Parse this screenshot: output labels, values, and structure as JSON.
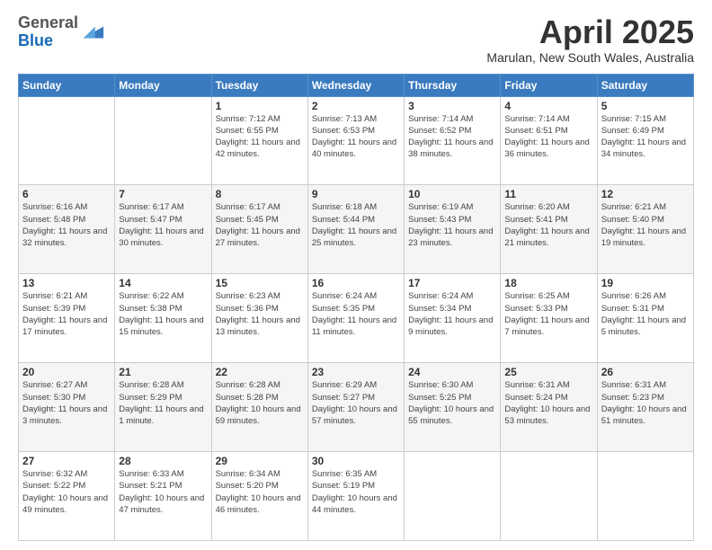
{
  "logo": {
    "line1": "General",
    "line2": "Blue"
  },
  "header": {
    "title": "April 2025",
    "location": "Marulan, New South Wales, Australia"
  },
  "days_of_week": [
    "Sunday",
    "Monday",
    "Tuesday",
    "Wednesday",
    "Thursday",
    "Friday",
    "Saturday"
  ],
  "weeks": [
    [
      {
        "day": "",
        "info": ""
      },
      {
        "day": "",
        "info": ""
      },
      {
        "day": "1",
        "info": "Sunrise: 7:12 AM\nSunset: 6:55 PM\nDaylight: 11 hours and 42 minutes."
      },
      {
        "day": "2",
        "info": "Sunrise: 7:13 AM\nSunset: 6:53 PM\nDaylight: 11 hours and 40 minutes."
      },
      {
        "day": "3",
        "info": "Sunrise: 7:14 AM\nSunset: 6:52 PM\nDaylight: 11 hours and 38 minutes."
      },
      {
        "day": "4",
        "info": "Sunrise: 7:14 AM\nSunset: 6:51 PM\nDaylight: 11 hours and 36 minutes."
      },
      {
        "day": "5",
        "info": "Sunrise: 7:15 AM\nSunset: 6:49 PM\nDaylight: 11 hours and 34 minutes."
      }
    ],
    [
      {
        "day": "6",
        "info": "Sunrise: 6:16 AM\nSunset: 5:48 PM\nDaylight: 11 hours and 32 minutes."
      },
      {
        "day": "7",
        "info": "Sunrise: 6:17 AM\nSunset: 5:47 PM\nDaylight: 11 hours and 30 minutes."
      },
      {
        "day": "8",
        "info": "Sunrise: 6:17 AM\nSunset: 5:45 PM\nDaylight: 11 hours and 27 minutes."
      },
      {
        "day": "9",
        "info": "Sunrise: 6:18 AM\nSunset: 5:44 PM\nDaylight: 11 hours and 25 minutes."
      },
      {
        "day": "10",
        "info": "Sunrise: 6:19 AM\nSunset: 5:43 PM\nDaylight: 11 hours and 23 minutes."
      },
      {
        "day": "11",
        "info": "Sunrise: 6:20 AM\nSunset: 5:41 PM\nDaylight: 11 hours and 21 minutes."
      },
      {
        "day": "12",
        "info": "Sunrise: 6:21 AM\nSunset: 5:40 PM\nDaylight: 11 hours and 19 minutes."
      }
    ],
    [
      {
        "day": "13",
        "info": "Sunrise: 6:21 AM\nSunset: 5:39 PM\nDaylight: 11 hours and 17 minutes."
      },
      {
        "day": "14",
        "info": "Sunrise: 6:22 AM\nSunset: 5:38 PM\nDaylight: 11 hours and 15 minutes."
      },
      {
        "day": "15",
        "info": "Sunrise: 6:23 AM\nSunset: 5:36 PM\nDaylight: 11 hours and 13 minutes."
      },
      {
        "day": "16",
        "info": "Sunrise: 6:24 AM\nSunset: 5:35 PM\nDaylight: 11 hours and 11 minutes."
      },
      {
        "day": "17",
        "info": "Sunrise: 6:24 AM\nSunset: 5:34 PM\nDaylight: 11 hours and 9 minutes."
      },
      {
        "day": "18",
        "info": "Sunrise: 6:25 AM\nSunset: 5:33 PM\nDaylight: 11 hours and 7 minutes."
      },
      {
        "day": "19",
        "info": "Sunrise: 6:26 AM\nSunset: 5:31 PM\nDaylight: 11 hours and 5 minutes."
      }
    ],
    [
      {
        "day": "20",
        "info": "Sunrise: 6:27 AM\nSunset: 5:30 PM\nDaylight: 11 hours and 3 minutes."
      },
      {
        "day": "21",
        "info": "Sunrise: 6:28 AM\nSunset: 5:29 PM\nDaylight: 11 hours and 1 minute."
      },
      {
        "day": "22",
        "info": "Sunrise: 6:28 AM\nSunset: 5:28 PM\nDaylight: 10 hours and 59 minutes."
      },
      {
        "day": "23",
        "info": "Sunrise: 6:29 AM\nSunset: 5:27 PM\nDaylight: 10 hours and 57 minutes."
      },
      {
        "day": "24",
        "info": "Sunrise: 6:30 AM\nSunset: 5:25 PM\nDaylight: 10 hours and 55 minutes."
      },
      {
        "day": "25",
        "info": "Sunrise: 6:31 AM\nSunset: 5:24 PM\nDaylight: 10 hours and 53 minutes."
      },
      {
        "day": "26",
        "info": "Sunrise: 6:31 AM\nSunset: 5:23 PM\nDaylight: 10 hours and 51 minutes."
      }
    ],
    [
      {
        "day": "27",
        "info": "Sunrise: 6:32 AM\nSunset: 5:22 PM\nDaylight: 10 hours and 49 minutes."
      },
      {
        "day": "28",
        "info": "Sunrise: 6:33 AM\nSunset: 5:21 PM\nDaylight: 10 hours and 47 minutes."
      },
      {
        "day": "29",
        "info": "Sunrise: 6:34 AM\nSunset: 5:20 PM\nDaylight: 10 hours and 46 minutes."
      },
      {
        "day": "30",
        "info": "Sunrise: 6:35 AM\nSunset: 5:19 PM\nDaylight: 10 hours and 44 minutes."
      },
      {
        "day": "",
        "info": ""
      },
      {
        "day": "",
        "info": ""
      },
      {
        "day": "",
        "info": ""
      }
    ]
  ]
}
